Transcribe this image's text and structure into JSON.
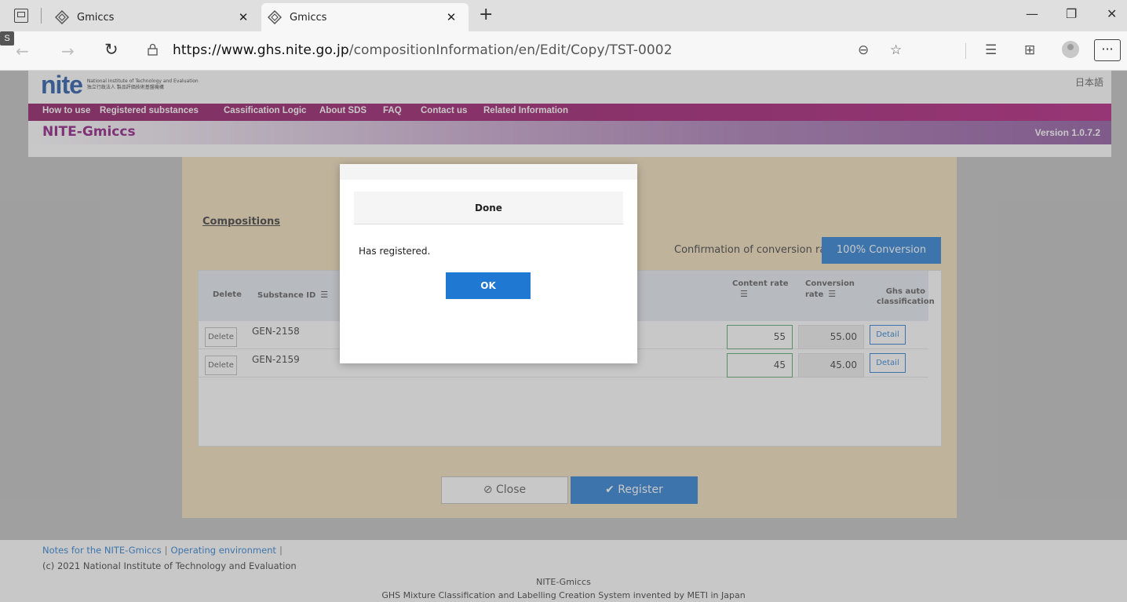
{
  "browser": {
    "tabs": [
      {
        "title": "Gmiccs",
        "active": false
      },
      {
        "title": "Gmiccs",
        "active": true
      }
    ],
    "url_host": "https://www.ghs.nite.go.jp",
    "url_path": "/compositionInformation/en/Edit/Copy/TST-0002",
    "profile_badge": "S"
  },
  "site": {
    "logo_text": "nite",
    "logo_sub_en": "National Institute of Technology and Evaluation",
    "logo_sub_jp": "独立行政法人 製品評価技術基盤機構",
    "language_link": "日本語",
    "nav": [
      "How to use",
      "Registered substances",
      "Cassification Logic",
      "About SDS",
      "FAQ",
      "Contact us",
      "Related Information"
    ],
    "brand_title": "NITE-Gmiccs",
    "version": "Version 1.0.7.2"
  },
  "panel": {
    "section_title": "Compositions",
    "conversion_label": "Confirmation of conversion rate",
    "conversion_button": "100% Conversion",
    "headers": {
      "delete": "Delete",
      "substance_id": "Substance ID",
      "content_rate": "Content rate",
      "conversion_rate_1": "Conversion",
      "conversion_rate_2": "rate",
      "ghs_1": "Ghs auto",
      "ghs_2": "classification"
    },
    "rows": [
      {
        "delete": "Delete",
        "substance_id": "GEN-2158",
        "content_rate": "55",
        "conversion_rate": "55.00",
        "detail": "Detail"
      },
      {
        "delete": "Delete",
        "substance_id": "GEN-2159",
        "content_rate": "45",
        "conversion_rate": "45.00",
        "detail": "Detail"
      }
    ],
    "close_button": "Close",
    "register_button": "Register"
  },
  "dialog": {
    "title": "Done",
    "message": "Has registered.",
    "ok_button": "OK"
  },
  "footer": {
    "link_notes": "Notes for the NITE-Gmiccs",
    "link_env": "Operating environment",
    "copyright": "(c) 2021 National Institute of Technology and Evaluation",
    "center_1": "NITE-Gmiccs",
    "center_2": "GHS Mixture Classification and Labelling Creation System invented by METI in Japan"
  },
  "colors": {
    "accent_blue": "#1f78d1",
    "nav_magenta": "#9a0f68",
    "panel_tan": "#f1ddb7"
  }
}
